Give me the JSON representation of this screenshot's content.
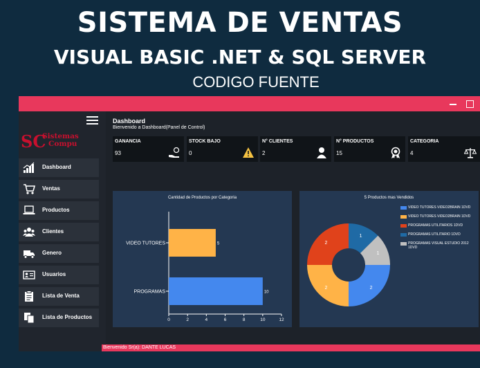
{
  "promo": {
    "title": "SISTEMA DE VENTAS",
    "subtitle": "VISUAL BASIC .NET & SQL SERVER",
    "code": "CODIGO FUENTE"
  },
  "brand": {
    "initials": "SC",
    "line1": "Sistemas",
    "line2": "Compu",
    "color": "#c8102e"
  },
  "colors": {
    "accent": "#e8385c",
    "blue": "#4488ee",
    "orange": "#ffb347",
    "red": "#e0421b",
    "darkblue": "#1f6aa5",
    "gray": "#c0c0c0"
  },
  "sidebar": {
    "items": [
      {
        "label": "Dashboard",
        "icon": "bar-chart-icon"
      },
      {
        "label": "Ventas",
        "icon": "cart-icon"
      },
      {
        "label": "Productos",
        "icon": "laptop-icon"
      },
      {
        "label": "Clientes",
        "icon": "users-icon"
      },
      {
        "label": "Genero",
        "icon": "truck-icon"
      },
      {
        "label": "Usuarios",
        "icon": "id-card-icon"
      },
      {
        "label": "Lista de Venta",
        "icon": "clipboard-icon"
      },
      {
        "label": "Lista de Productos",
        "icon": "documents-icon"
      }
    ]
  },
  "header": {
    "title": "Dashboard",
    "subtitle": "Bienvenido a Dashboard(Panel de Control)"
  },
  "cards": [
    {
      "title": "GANANCIA",
      "value": "93",
      "icon": "money-hand-icon"
    },
    {
      "title": "STOCK BAJO",
      "value": "0",
      "icon": "warning-icon"
    },
    {
      "title": "N° CLIENTES",
      "value": "2",
      "icon": "user-icon"
    },
    {
      "title": "N° PRODUCTOS",
      "value": "15",
      "icon": "award-icon"
    },
    {
      "title": "CATEGORIA",
      "value": "4",
      "icon": "scale-icon"
    }
  ],
  "chart_data": [
    {
      "type": "bar",
      "orientation": "horizontal",
      "title": "Cantidad de Productos por Categoria",
      "categories": [
        "VIDEO TUTORES",
        "PROGRAMAS"
      ],
      "values": [
        5,
        10
      ],
      "colors": [
        "#ffb347",
        "#4488ee"
      ],
      "xlim": [
        0,
        12
      ],
      "xticks": [
        0,
        2,
        4,
        6,
        8,
        10,
        12
      ],
      "data_labels": true
    },
    {
      "type": "pie",
      "donut": true,
      "title": "5 Productos mas Vendidos",
      "legend_position": "right",
      "slices": [
        {
          "name": "VIDEO TUTORES VIDEO2BRAIN 1DVD",
          "value": 2,
          "color": "#4488ee"
        },
        {
          "name": "VIDEO TUTORES VIDEO2BRAIN 1DVD",
          "value": 2,
          "color": "#ffb347"
        },
        {
          "name": "PROGRAMAS UTILITARIOS 1DVD",
          "value": 2,
          "color": "#e0421b"
        },
        {
          "name": "PROGRAMAS UTILITARIO 1DVD",
          "value": 1,
          "color": "#1f6aa5"
        },
        {
          "name": "PROGRAMAS VISUAL ESTUDIO 2012 1DVD",
          "value": 1,
          "color": "#c0c0c0"
        }
      ]
    }
  ],
  "status": {
    "text": "Bienvenido Sr(a):   DANTE LUCAS"
  }
}
